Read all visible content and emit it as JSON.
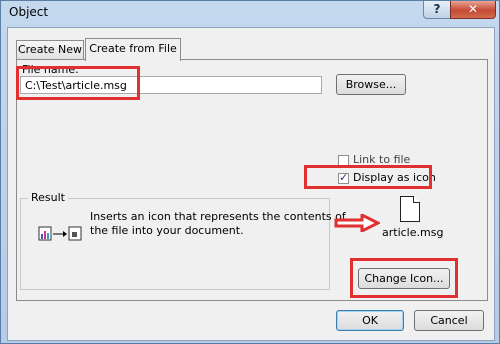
{
  "window": {
    "title": "Object",
    "help_glyph": "?",
    "close_glyph": "✕"
  },
  "tabs": [
    {
      "label": "Create New",
      "active": false
    },
    {
      "label": "Create from File",
      "active": true
    }
  ],
  "file_name": {
    "label": "File name:",
    "value": "C:\\Test\\article.msg"
  },
  "browse_label": "Browse...",
  "link_to_file": {
    "label": "Link to file",
    "checked": false
  },
  "display_as_icon": {
    "label": "Display as icon",
    "checked": true
  },
  "result": {
    "title": "Result",
    "description_line1": "Inserts an icon that represents the contents of",
    "description_line2": "the file into your document."
  },
  "icon_preview": {
    "caption": "article.msg"
  },
  "change_icon_label": "Change Icon...",
  "ok_label": "OK",
  "cancel_label": "Cancel",
  "colors": {
    "highlight": "#e03030",
    "close_button": "#c54a35"
  }
}
